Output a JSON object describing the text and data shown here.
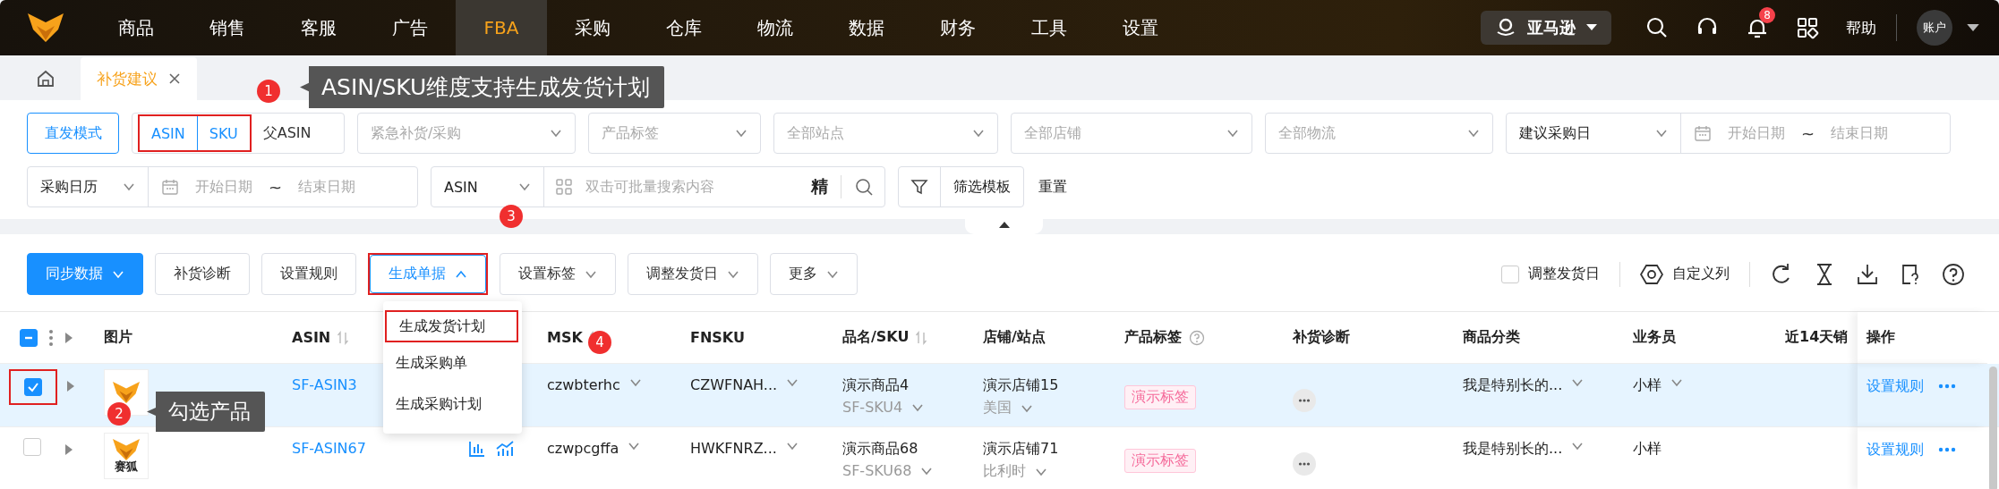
{
  "top_nav": {
    "items": [
      {
        "label": "商品",
        "selected": false
      },
      {
        "label": "销售",
        "selected": false
      },
      {
        "label": "客服",
        "selected": false
      },
      {
        "label": "广告",
        "selected": false
      },
      {
        "label": "FBA",
        "selected": true
      },
      {
        "label": "采购",
        "selected": false
      },
      {
        "label": "仓库",
        "selected": false
      },
      {
        "label": "物流",
        "selected": false
      },
      {
        "label": "数据",
        "selected": false
      },
      {
        "label": "财务",
        "selected": false
      },
      {
        "label": "工具",
        "selected": false
      },
      {
        "label": "设置",
        "selected": false
      }
    ],
    "marketplace": "亚马逊",
    "notifications": "8",
    "help": "帮助",
    "account": "账户"
  },
  "page_tabs": [
    {
      "label": "补货建议",
      "selected": true
    }
  ],
  "filters": {
    "mode_button": "直发模式",
    "dimension": [
      {
        "label": "ASIN",
        "selected": true,
        "highlighted": true
      },
      {
        "label": "SKU",
        "selected": true,
        "highlighted": true
      },
      {
        "label": "父ASIN",
        "selected": false,
        "highlighted": false
      }
    ],
    "selects": [
      {
        "placeholder": "紧急补货/采购"
      },
      {
        "placeholder": "产品标签"
      },
      {
        "placeholder": "全部站点"
      },
      {
        "placeholder": "全部店铺"
      },
      {
        "placeholder": "全部物流"
      }
    ],
    "suggest_date": {
      "value": "建议采购日",
      "start": "开始日期",
      "separator": "~",
      "end": "结束日期"
    },
    "calendar_date": {
      "value": "采购日历",
      "start": "开始日期",
      "separator": "~",
      "end": "结束日期"
    },
    "search": {
      "type": "ASIN",
      "placeholder": "双击可批量搜索内容",
      "exact": "精"
    },
    "template": "筛选模板",
    "reset": "重置"
  },
  "toolbar": {
    "buttons": [
      {
        "label": "同步数据",
        "kind": "primary",
        "dropdown": true,
        "expanded": false,
        "highlighted": false
      },
      {
        "label": "补货诊断",
        "kind": "default",
        "dropdown": false,
        "expanded": false,
        "highlighted": false
      },
      {
        "label": "设置规则",
        "kind": "default",
        "dropdown": false,
        "expanded": false,
        "highlighted": false
      },
      {
        "label": "生成单据",
        "kind": "default",
        "dropdown": true,
        "expanded": true,
        "highlighted": true
      },
      {
        "label": "设置标签",
        "kind": "default",
        "dropdown": true,
        "expanded": false,
        "highlighted": false
      },
      {
        "label": "调整发货日",
        "kind": "default",
        "dropdown": true,
        "expanded": false,
        "highlighted": false
      },
      {
        "label": "更多",
        "kind": "default",
        "dropdown": true,
        "expanded": false,
        "highlighted": false
      }
    ],
    "adjust_ship_day": {
      "label": "调整发货日",
      "checked": false
    },
    "custom_columns": "自定义列"
  },
  "dropdown_menu": {
    "items": [
      {
        "label": "生成发货计划",
        "highlighted": true
      },
      {
        "label": "生成采购单",
        "highlighted": false
      },
      {
        "label": "生成采购计划",
        "highlighted": false
      }
    ]
  },
  "table": {
    "select_all": {
      "indeterminate": true
    },
    "columns": [
      {
        "label": "图片",
        "sortable": false,
        "help": false
      },
      {
        "label": "ASIN",
        "sortable": true,
        "help": false
      },
      {
        "label": "MSK",
        "sortable": true,
        "help": false
      },
      {
        "label": "FNSKU",
        "sortable": false,
        "help": false
      },
      {
        "label": "品名/SKU",
        "sortable": true,
        "help": false
      },
      {
        "label": "店铺/站点",
        "sortable": false,
        "help": false
      },
      {
        "label": "产品标签",
        "sortable": false,
        "help": true
      },
      {
        "label": "补货诊断",
        "sortable": false,
        "help": false
      },
      {
        "label": "商品分类",
        "sortable": false,
        "help": false
      },
      {
        "label": "业务员",
        "sortable": false,
        "help": false
      },
      {
        "label": "近14天销",
        "sortable": false,
        "help": false
      },
      {
        "label": "操作",
        "sortable": false,
        "help": false
      }
    ],
    "rows": [
      {
        "selected": true,
        "highlighted": true,
        "image_label": "",
        "asin": "SF-ASIN3",
        "trend_icons": false,
        "msku": "czwbterhc",
        "fnsku": "CZWFNAH...",
        "product_name": "演示商品4",
        "sku": "SF-SKU4",
        "store": "演示店铺15",
        "site": "美国",
        "tag": "演示标签",
        "category": "我是特别长的...",
        "salesperson": "小样",
        "salesperson_editable": true,
        "action": "设置规则"
      },
      {
        "selected": false,
        "highlighted": false,
        "image_label": "赛狐",
        "asin": "SF-ASIN67",
        "trend_icons": true,
        "msku": "czwpcgffa",
        "fnsku": "HWKFNRZ...",
        "product_name": "演示商品68",
        "sku": "SF-SKU68",
        "store": "演示店铺71",
        "site": "比利时",
        "tag": "演示标签",
        "category": "我是特别长的...",
        "salesperson": "小样",
        "salesperson_editable": false,
        "action": "设置规则"
      }
    ]
  },
  "annotations": [
    {
      "number": "1",
      "text": "ASIN/SKU维度支持生成发货计划"
    },
    {
      "number": "2",
      "text": "勾选产品"
    },
    {
      "number": "3"
    },
    {
      "number": "4"
    }
  ]
}
